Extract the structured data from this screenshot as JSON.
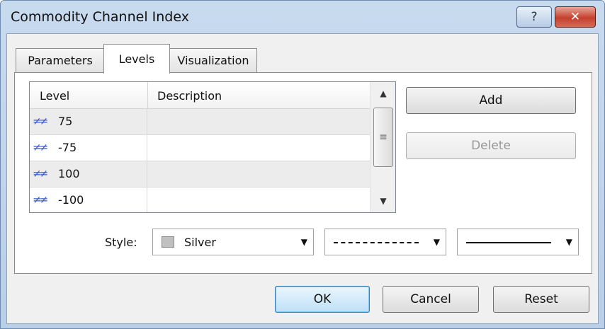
{
  "window": {
    "title": "Commodity Channel Index",
    "help_label": "?",
    "close_label": "✕"
  },
  "tabs": [
    {
      "label": "Parameters",
      "active": false
    },
    {
      "label": "Levels",
      "active": true
    },
    {
      "label": "Visualization",
      "active": false
    }
  ],
  "levels_table": {
    "headers": {
      "level": "Level",
      "description": "Description"
    },
    "rows": [
      {
        "level": "75",
        "description": ""
      },
      {
        "level": "-75",
        "description": ""
      },
      {
        "level": "100",
        "description": ""
      },
      {
        "level": "-100",
        "description": ""
      }
    ]
  },
  "buttons": {
    "add": "Add",
    "delete": "Delete",
    "ok": "OK",
    "cancel": "Cancel",
    "reset": "Reset"
  },
  "style": {
    "label": "Style:",
    "color_name": "Silver",
    "color_hex": "#c0c0c0"
  },
  "icons": {
    "level_icon": "≠≠",
    "dropdown": "▼",
    "scroll_up": "▲",
    "scroll_down": "▼",
    "grip": "≡"
  }
}
